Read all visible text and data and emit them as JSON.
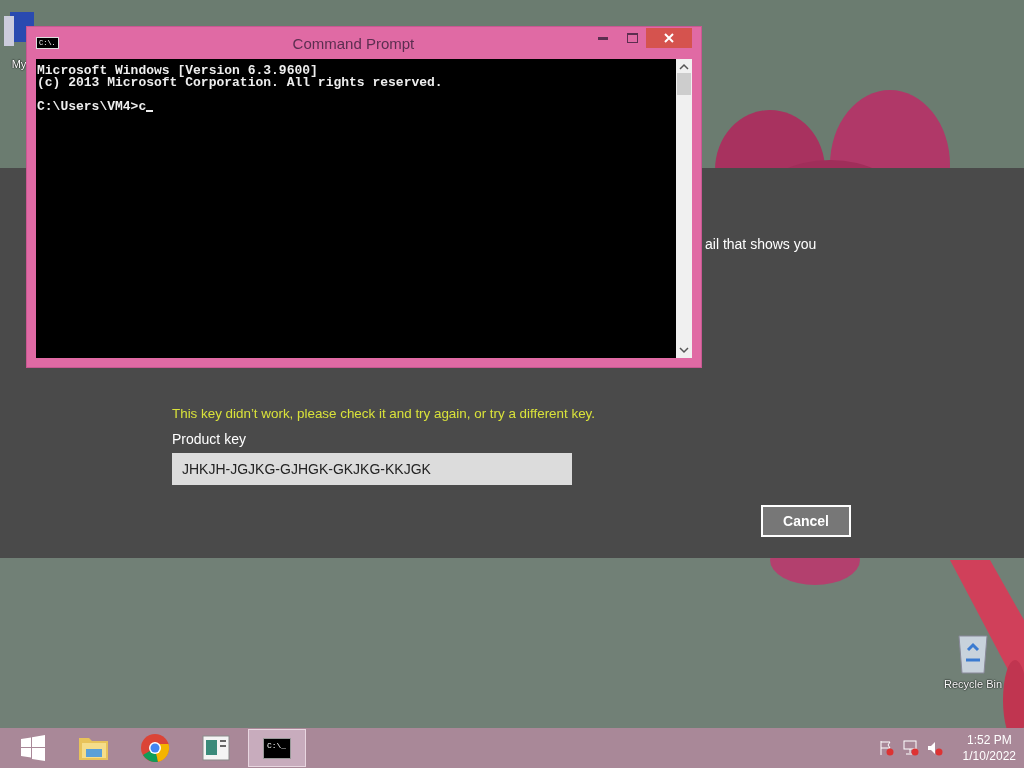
{
  "desktop_icons": [
    {
      "label": "My"
    },
    {
      "label": "Recycle Bin"
    }
  ],
  "activation_dialog": {
    "partial_text": "ail that shows you",
    "error": "This key didn’t work, please check it and try again, or try a different key.",
    "field_label": "Product key",
    "product_key": "JHKJH-JGJKG-GJHGK-GKJKG-KKJGK",
    "cancel_button": "Cancel"
  },
  "console_window": {
    "title": "Command Prompt",
    "icon_label": "C:\\.",
    "lines": [
      "Microsoft Windows [Version 6.3.9600]",
      "(c) 2013 Microsoft Corporation. All rights reserved."
    ],
    "prompt": "C:\\Users\\VM4>c"
  },
  "taskbar": {
    "items": [
      {
        "kind": "start",
        "selected": false
      },
      {
        "kind": "folder",
        "selected": false
      },
      {
        "kind": "browser",
        "selected": false
      },
      {
        "kind": "document",
        "selected": false
      },
      {
        "kind": "console",
        "selected": true,
        "label": "C:\\_"
      }
    ],
    "time": "1:52 PM",
    "date": "1/10/2022"
  }
}
